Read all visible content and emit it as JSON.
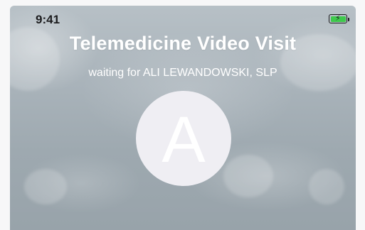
{
  "status_bar": {
    "time": "9:41",
    "battery_icon": "battery-charging-icon",
    "battery_color": "#3ec94c"
  },
  "call": {
    "title": "Telemedicine Video Visit",
    "subtitle": "waiting for ALI LEWANDOWSKI, SLP",
    "avatar_initial": "A"
  }
}
